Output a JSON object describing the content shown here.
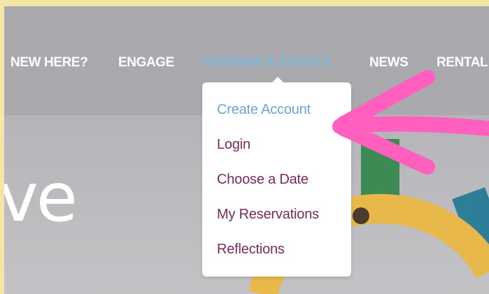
{
  "nav": {
    "items": [
      {
        "label": "NEW HERE?",
        "active": false
      },
      {
        "label": "ENGAGE",
        "active": false
      },
      {
        "label": "WORSHIP & EVENTS",
        "active": true
      },
      {
        "label": "NEWS",
        "active": false
      },
      {
        "label": "RENTAL",
        "active": false
      }
    ]
  },
  "dropdown": {
    "items": [
      {
        "label": "Create Account",
        "active": true
      },
      {
        "label": "Login",
        "active": false
      },
      {
        "label": "Choose a Date",
        "active": false
      },
      {
        "label": "My Reservations",
        "active": false
      },
      {
        "label": "Reflections",
        "active": false
      }
    ]
  },
  "hero": {
    "text": "ve"
  },
  "colors": {
    "nav_text": "#ffffff",
    "nav_active": "#7db9d8",
    "menu_text": "#7a2b5a",
    "menu_active": "#6aa8cf",
    "annotation_arrow": "#ff5fbf",
    "outer_border": "#f5e6a8"
  }
}
